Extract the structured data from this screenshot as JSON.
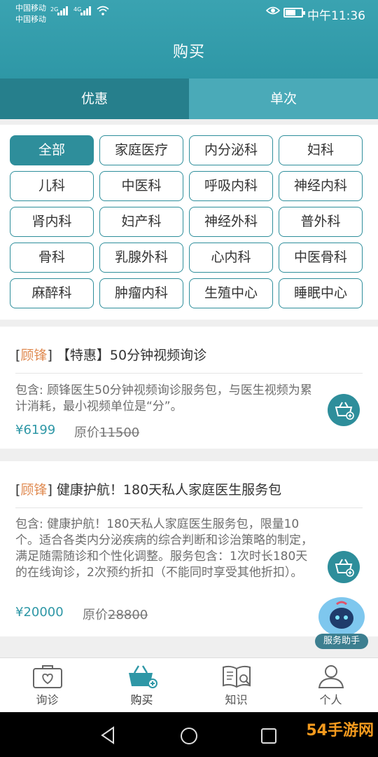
{
  "status_bar": {
    "carrier_1": "中国移动",
    "carrier_2": "中国移动",
    "network_1": "2G",
    "network_2": "4G",
    "time": "中午11:36"
  },
  "header": {
    "title": "购买"
  },
  "tabs": [
    {
      "label": "优惠",
      "active": true
    },
    {
      "label": "单次",
      "active": false
    }
  ],
  "categories": [
    "全部",
    "家庭医疗",
    "内分泌科",
    "妇科",
    "儿科",
    "中医科",
    "呼吸内科",
    "神经内科",
    "肾内科",
    "妇产科",
    "神经外科",
    "普外科",
    "骨科",
    "乳腺外科",
    "心内科",
    "中医骨科",
    "麻醉科",
    "肿瘤内科",
    "生殖中心",
    "睡眠中心"
  ],
  "selected_category": "全部",
  "products": [
    {
      "doctor": "顾锋",
      "title": "【特惠】50分钟视频询诊",
      "description": "包含: 顾锋医生50分钟视频询诊服务包，与医生视频为累计消耗，最小视频单位是“分”。",
      "price": "¥6199",
      "original_label": "原价",
      "original_price": "11500"
    },
    {
      "doctor": "顾锋",
      "title": "健康护航！180天私人家庭医生服务包",
      "description": "包含: 健康护航！180天私人家庭医生服务包，限量10个。适合各类内分泌疾病的综合判断和诊治策略的制定，满足随需随诊和个性化调整。服务包含：1次时长180天的在线询诊，2次预约折扣（不能同时享受其他折扣）。",
      "price": "¥20000",
      "original_label": "原价",
      "original_price": "28800"
    }
  ],
  "assistant": {
    "label": "服务助手"
  },
  "bottom_nav": [
    {
      "label": "询诊",
      "icon": "medical-kit-icon",
      "active": false
    },
    {
      "label": "购买",
      "icon": "basket-icon",
      "active": true
    },
    {
      "label": "知识",
      "icon": "book-icon",
      "active": false
    },
    {
      "label": "个人",
      "icon": "person-icon",
      "active": false
    }
  ],
  "watermark": "54手游网",
  "colors": {
    "primary": "#2e97a6",
    "tab_active": "#267f8c",
    "doctor_name": "#e08b52"
  }
}
